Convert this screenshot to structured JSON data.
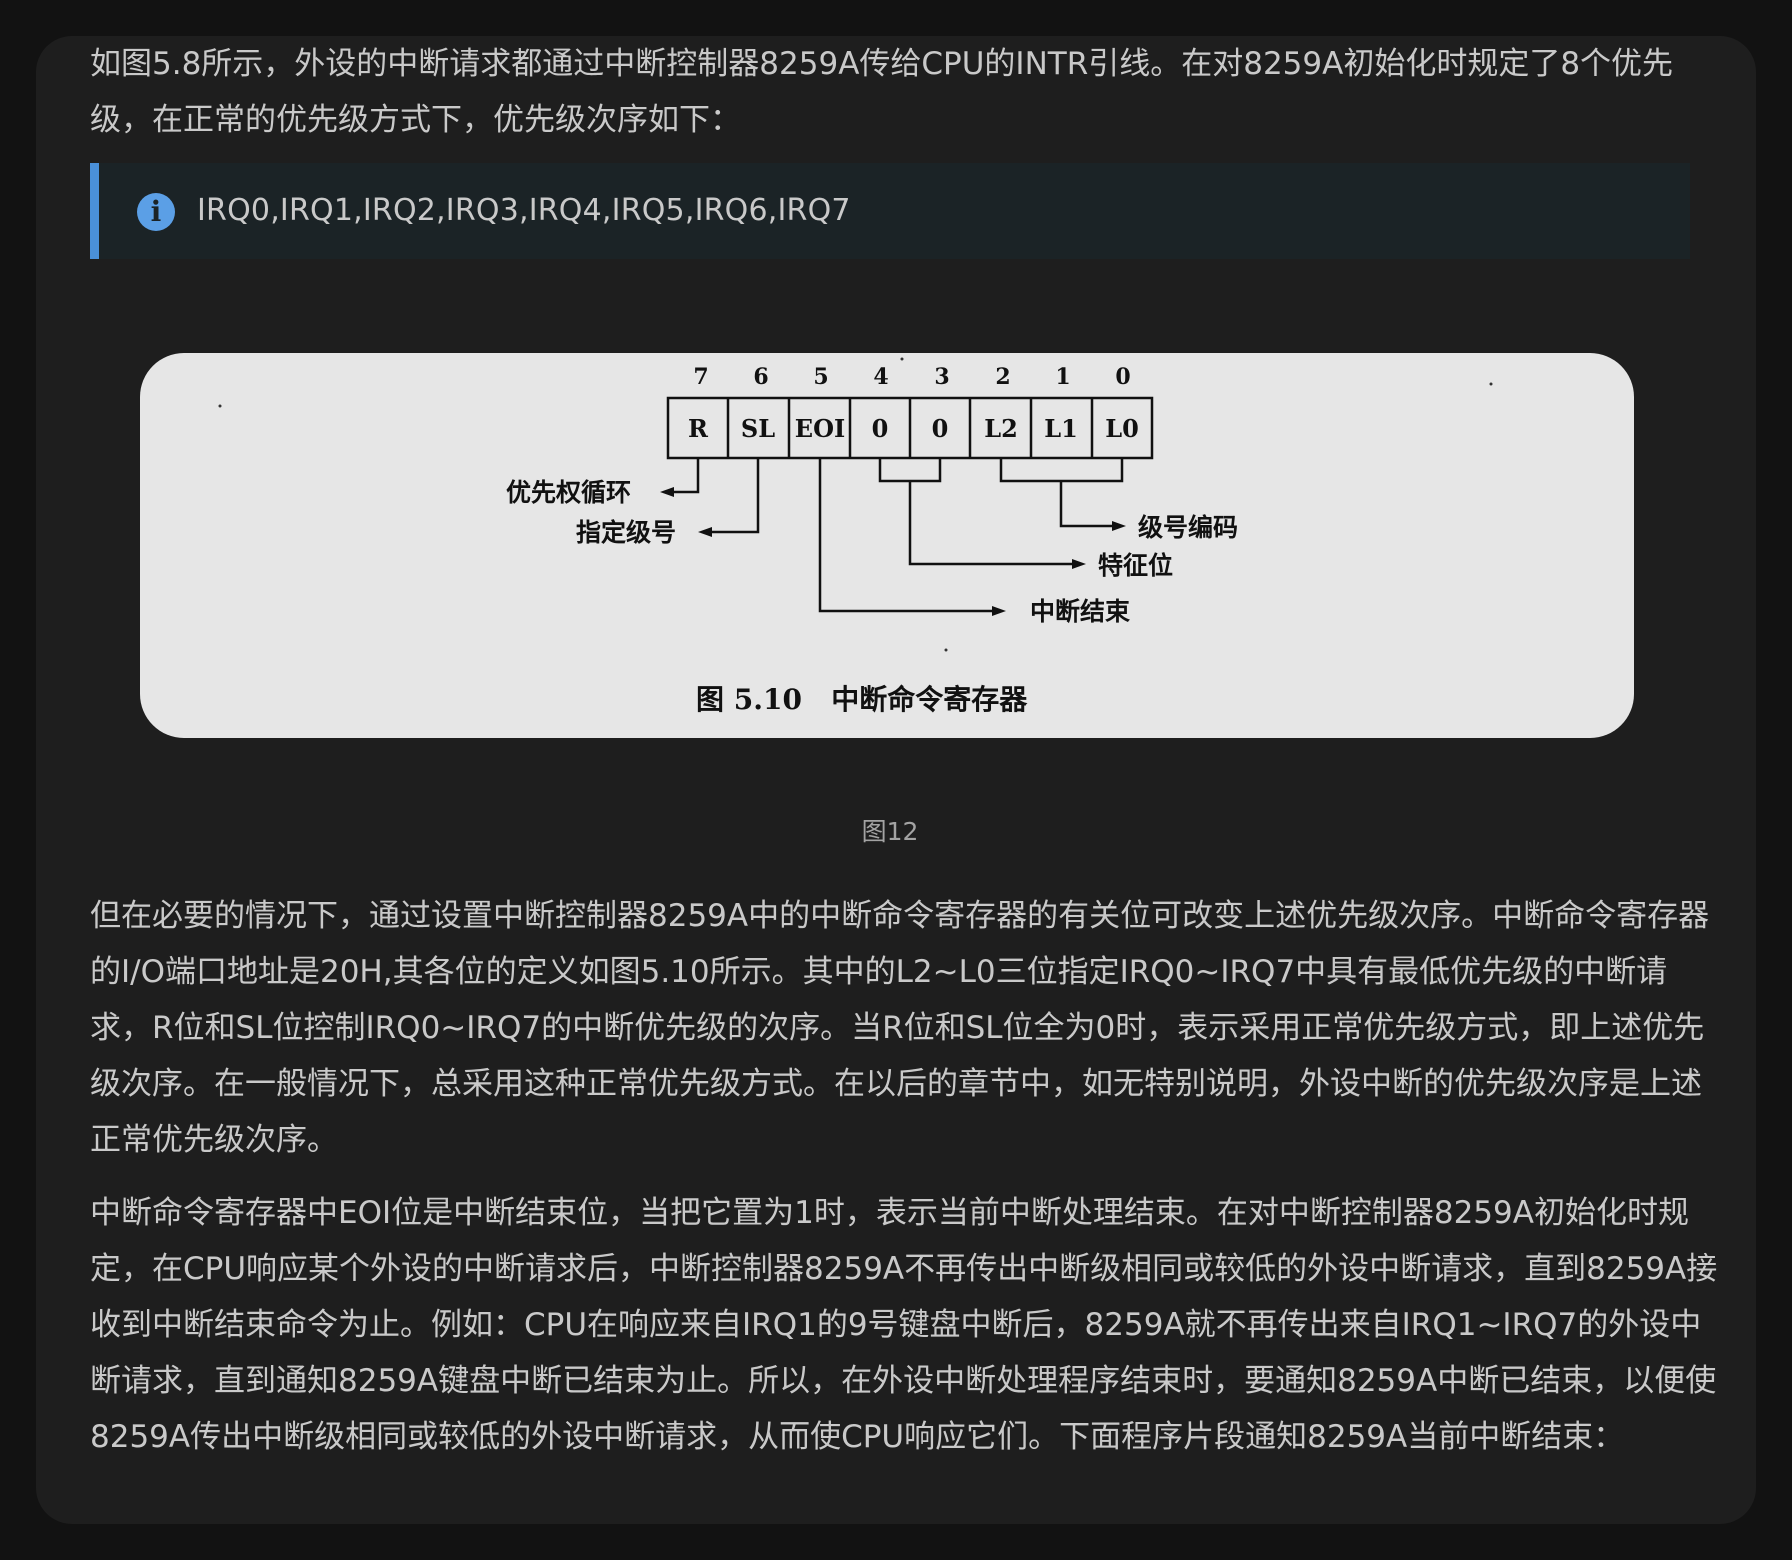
{
  "paragraphs": {
    "intro": "如图5.8所示，外设的中断请求都通过中断控制器8259A传给CPU的INTR引线。在对8259A初始化时规定了8个优先级，在正常的优先级方式下，优先级次序如下：",
    "body1": "但在必要的情况下，通过设置中断控制器8259A中的中断命令寄存器的有关位可改变上述优先级次序。中断命令寄存器的I/O端口地址是20H,其各位的定义如图5.10所示。其中的L2~L0三位指定IRQ0~IRQ7中具有最低优先级的中断请求，R位和SL位控制IRQ0~IRQ7的中断优先级的次序。当R位和SL位全为0时，表示采用正常优先级方式，即上述优先级次序。在一般情况下，总采用这种正常优先级方式。在以后的章节中，如无特别说明，外设中断的优先级次序是上述正常优先级次序。",
    "body2": "中断命令寄存器中EOI位是中断结束位，当把它置为1时，表示当前中断处理结束。在对中断控制器8259A初始化时规定，在CPU响应某个外设的中断请求后，中断控制器8259A不再传出中断级相同或较低的外设中断请求，直到8259A接收到中断结束命令为止。例如：CPU在响应来自IRQ1的9号键盘中断后，8259A就不再传出来自IRQ1~IRQ7的外设中断请求，直到通知8259A键盘中断已结束为止。所以，在外设中断处理程序结束时，要通知8259A中断已结束，以便使8259A传出中断级相同或较低的外设中断请求，从而使CPU响应它们。下面程序片段通知8259A当前中断结束："
  },
  "callout": {
    "icon": "info-icon",
    "text": "IRQ0,IRQ1,IRQ2,IRQ3,IRQ4,IRQ5,IRQ6,IRQ7",
    "accent": "#4a90d9"
  },
  "figure": {
    "bit_numbers": [
      "7",
      "6",
      "5",
      "4",
      "3",
      "2",
      "1",
      "0"
    ],
    "bit_labels": [
      "R",
      "SL",
      "EOI",
      "0",
      "0",
      "L2",
      "L1",
      "L0"
    ],
    "annotations": {
      "rotate": "优先权循环",
      "specific": "指定级号",
      "level_code": "级号编码",
      "feature": "特征位",
      "eoi": "中断结束"
    },
    "title": "图 5.10   中断命令寄存器",
    "caption": "图12"
  }
}
